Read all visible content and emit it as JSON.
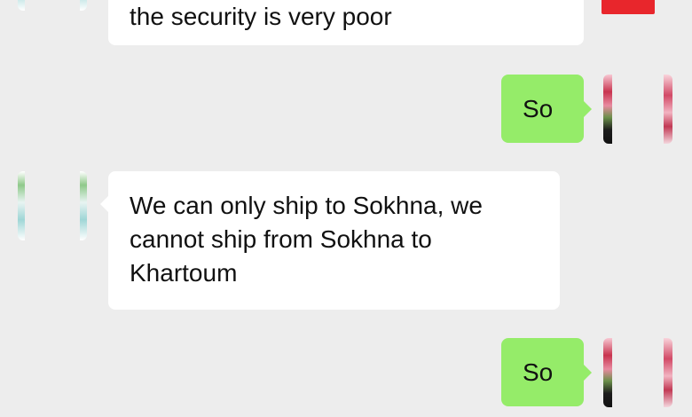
{
  "messages": [
    {
      "side": "left",
      "text": "the security is very poor"
    },
    {
      "side": "right",
      "text": "So"
    },
    {
      "side": "left",
      "lines": [
        "We can only ship to Sokhna, we",
        "cannot ship from Sokhna to",
        "Khartoum"
      ]
    },
    {
      "side": "right",
      "text": "So"
    }
  ],
  "colors": {
    "background": "#ededed",
    "incoming_bubble": "#ffffff",
    "outgoing_bubble": "#95ec69",
    "badge": "#e8262c"
  },
  "icons": {
    "left_avatar": "avatar-plant-photo",
    "right_avatar": "avatar-flower-photo",
    "badge": "red-badge-partial"
  }
}
